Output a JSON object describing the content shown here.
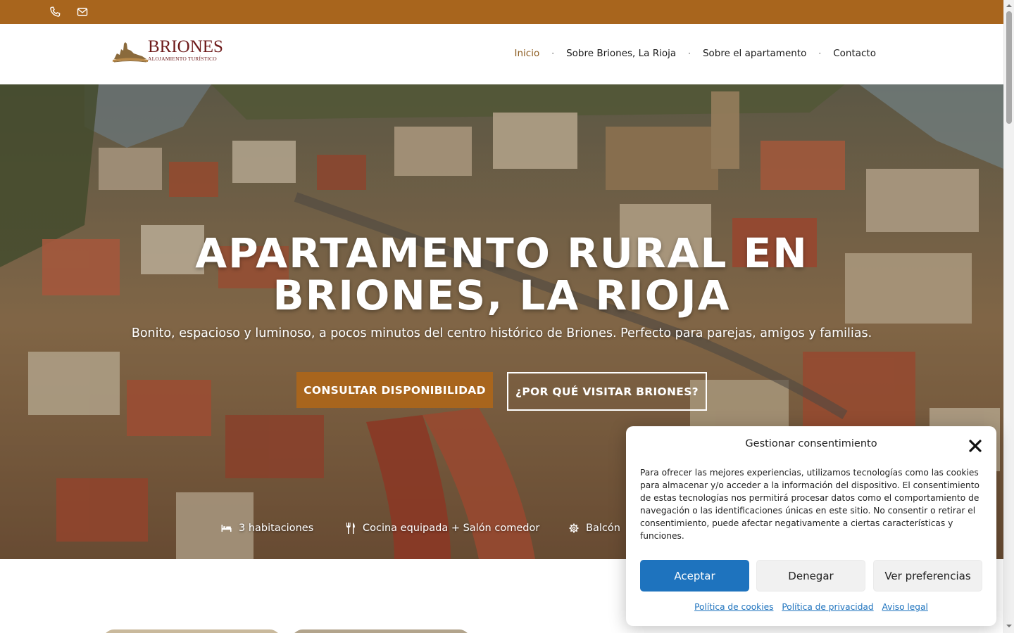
{
  "topbar": {
    "icons": [
      "phone-icon",
      "mail-icon"
    ],
    "background": "#a8651d"
  },
  "header": {
    "logo": {
      "brand": "BRIONES",
      "tagline": "ALOJAMIENTO TURÍSTICO"
    },
    "nav": [
      {
        "label": "Inicio",
        "active": true
      },
      {
        "label": "Sobre Briones, La Rioja",
        "active": false
      },
      {
        "label": "Sobre el apartamento",
        "active": false
      },
      {
        "label": "Contacto",
        "active": false
      }
    ]
  },
  "hero": {
    "title_line1": "APARTAMENTO RURAL EN",
    "title_line2": "BRIONES, LA RIOJA",
    "subtitle": "Bonito, espacioso y luminoso, a pocos minutos del centro histórico de Briones. Perfecto para parejas, amigos y familias.",
    "primary_button": "CONSULTAR DISPONIBILIDAD",
    "secondary_button": "¿POR QUÉ VISITAR BRIONES?",
    "features": [
      {
        "icon": "bed-icon",
        "label": "3 habitaciones"
      },
      {
        "icon": "cutlery-icon",
        "label": "Cocina equipada + Salón comedor"
      },
      {
        "icon": "gear-icon",
        "label": "Balcón"
      }
    ]
  },
  "consent": {
    "title": "Gestionar consentimiento",
    "body": "Para ofrecer las mejores experiencias, utilizamos tecnologías como las cookies para almacenar y/o acceder a la información del dispositivo. El consentimiento de estas tecnologías nos permitirá procesar datos como el comportamiento de navegación o las identificaciones únicas en este sitio. No consentir o retirar el consentimiento, puede afectar negativamente a ciertas características y funciones.",
    "accept": "Aceptar",
    "deny": "Denegar",
    "preferences": "Ver preferencias",
    "links": [
      "Política de cookies",
      "Política de privacidad",
      "Aviso legal"
    ]
  },
  "colors": {
    "accent": "#a8651d",
    "brand": "#6e1b1b",
    "consent_primary": "#1e73be"
  }
}
